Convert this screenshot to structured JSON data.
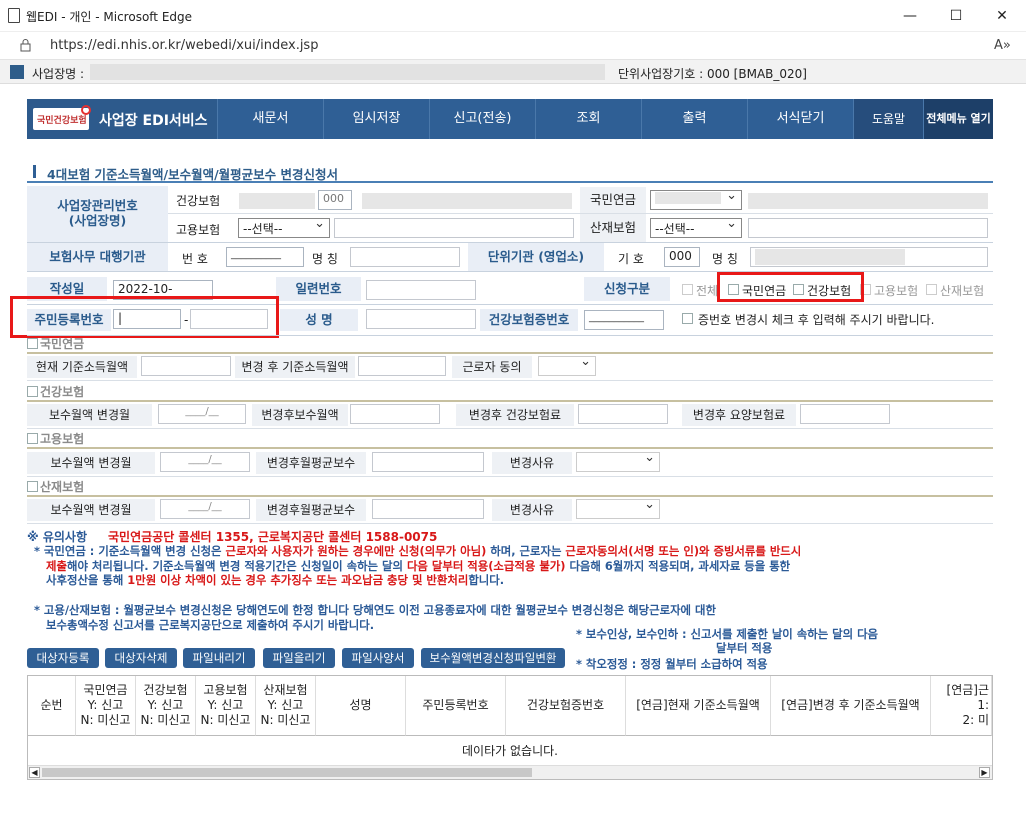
{
  "window": {
    "title": "웹EDI - 개인 - Microsoft Edge",
    "url": "https://edi.nhis.or.kr/webedi/xui/index.jsp",
    "minimize": "—",
    "maximize": "☐",
    "close": "✕",
    "read_aloud": "A»"
  },
  "bizbar": {
    "label": "사업장명 :",
    "unit_code": "단위사업장기호 : 000 [BMAB_020]"
  },
  "nav": {
    "logo_text": "사업장 EDI서비스",
    "logo_mark": "국민건강보험",
    "items": [
      "새문서",
      "임시저장",
      "신고(전송)",
      "조회",
      "출력",
      "서식닫기"
    ],
    "help": "도움말",
    "menu": "전체메뉴 열기"
  },
  "form": {
    "title": "4대보험 기준소득월액/보수월액/월평균보수 변경신청서",
    "biz_no_label": "사업장관리번호\n(사업장명)",
    "health": "건강보험",
    "health_code": "000",
    "pension": "국민연금",
    "employment": "고용보험",
    "employment_select": "--선택--",
    "industrial": "산재보험",
    "industrial_select": "--선택--",
    "agency_label": "보험사무 대행기관",
    "agency_no": "번 호",
    "agency_no_val": "__________",
    "agency_name": "명 칭",
    "unit_org_label": "단위기관 (영업소)",
    "unit_sign": "기 호",
    "unit_sign_val": "000",
    "unit_name": "명 칭",
    "date_label": "작성일",
    "date_val": "2022-10-",
    "serial_label": "일련번호",
    "apply_label": "신청구분",
    "apply_all": "전체",
    "apply_pension": "국민연금",
    "apply_health": "건강보험",
    "apply_employment": "고용보험",
    "apply_industrial": "산재보험",
    "rrn_label": "주민등록번호",
    "rrn_sep": "-",
    "name_label": "성   명",
    "health_card_label": "건강보험증번호",
    "health_card_val": "___________",
    "health_card_note": "증번호 변경시 체크 후 입력해 주시기 바랍니다."
  },
  "sections": {
    "pension": {
      "title": "국민연금",
      "f1": "현재 기준소득월액",
      "f2": "변경 후 기준소득월액",
      "f3": "근로자 동의"
    },
    "health": {
      "title": "건강보험",
      "f1": "보수월액 변경월",
      "f1_val": "____/__",
      "f2": "변경후보수월액",
      "f3": "변경후 건강보험료",
      "f4": "변경후 요양보험료"
    },
    "employment": {
      "title": "고용보험",
      "f1": "보수월액 변경월",
      "f1_val": "____/__",
      "f2": "변경후월평균보수",
      "f3": "변경사유"
    },
    "industrial": {
      "title": "산재보험",
      "f1": "보수월액 변경월",
      "f1_val": "____/__",
      "f2": "변경후월평균보수",
      "f3": "변경사유"
    }
  },
  "notes": {
    "head": "※ 유의사항",
    "head_red": "국민연금공단 콜센터 1355, 근로복지공단 콜센터 1588-0075",
    "l1a": "* 국민연금 : 기준소득월액 변경 신청은 ",
    "l1b": "근로자와 사용자가 원하는 경우에만 신청(의무가 아님)",
    "l1c": " 하며, 근로자는 ",
    "l1d": "근로자동의서(서명 또는 인)와 증빙서류를 반드시",
    "l2a": "제출",
    "l2b": "해야 처리됩니다. 기준소득월액 변경 적용기간은 신청일이 속하는 달의 ",
    "l2c": "다음 달부터 적용(소급적용 불가)",
    "l2d": " 다음해 6월까지 적용되며, 과세자료 등을 통한",
    "l3a": "사후정산을 통해 ",
    "l3b": "1만원 이상 차액이 있는 경우 추가징수 또는 과오납금 충당 및 반환처리",
    "l3c": "합니다.",
    "l4": "* 고용/산재보험 : 월평균보수 변경신청은 당해연도에 한정 합니다 당해연도 이전 고용종료자에 대한 월평균보수 변경신청은 해당근로자에 대한",
    "l5": "보수총액수정 신고서를 근로복지공단으로 제출하여 주시기 바랍니다.",
    "l6": "* 보수인상, 보수인하 : 신고서를 제출한 날이 속하는 달의 다음",
    "l7": "달부터 적용",
    "l8": "* 착오정정 : 정정 월부터 소급하여 적용"
  },
  "buttons": [
    "대상자등록",
    "대상자삭제",
    "파일내리기",
    "파일올리기",
    "파일사양서",
    "보수월액변경신청파일변환"
  ],
  "grid": {
    "headers": [
      "순번",
      "국민연금\nY: 신고\nN: 미신고",
      "건강보험\nY: 신고\nN: 미신고",
      "고용보험\nY: 신고\nN: 미신고",
      "산재보험\nY: 신고\nN: 미신고",
      "성명",
      "주민등록번호",
      "건강보험증번호",
      "[연금]현재 기준소득월액",
      "[연금]변경 후 기준소득월액",
      "[연금]근\n1: \n2: 미"
    ],
    "empty": "데이타가 없습니다."
  },
  "colors": {
    "nav": "#2f5f95",
    "label_text": "#2a5b8c",
    "red": "#d81818"
  }
}
